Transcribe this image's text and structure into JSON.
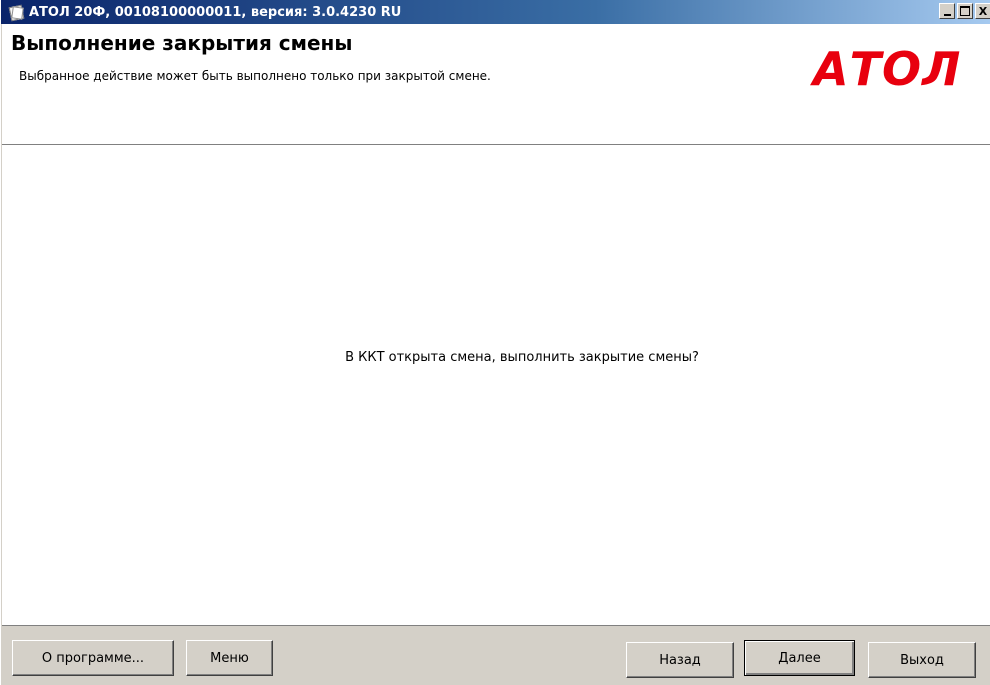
{
  "window": {
    "title": "АТОЛ 20Ф, 00108100000011, версия: 3.0.4230 RU",
    "minimize_label": "",
    "maximize_label": "",
    "close_label": "X"
  },
  "header": {
    "title": "Выполнение закрытия смены",
    "subtitle": "Выбранное действие может быть выполнено только при закрытой смене.",
    "logo_text": "АТОЛ",
    "logo_color": "#e8000e"
  },
  "main": {
    "message": "В ККТ открыта смена, выполнить закрытие смены?"
  },
  "footer": {
    "about_label": "О программе...",
    "menu_label": "Меню",
    "back_label": "Назад",
    "next_label": "Далее",
    "exit_label": "Выход"
  },
  "icons": {
    "app_icon": "document-icon"
  }
}
